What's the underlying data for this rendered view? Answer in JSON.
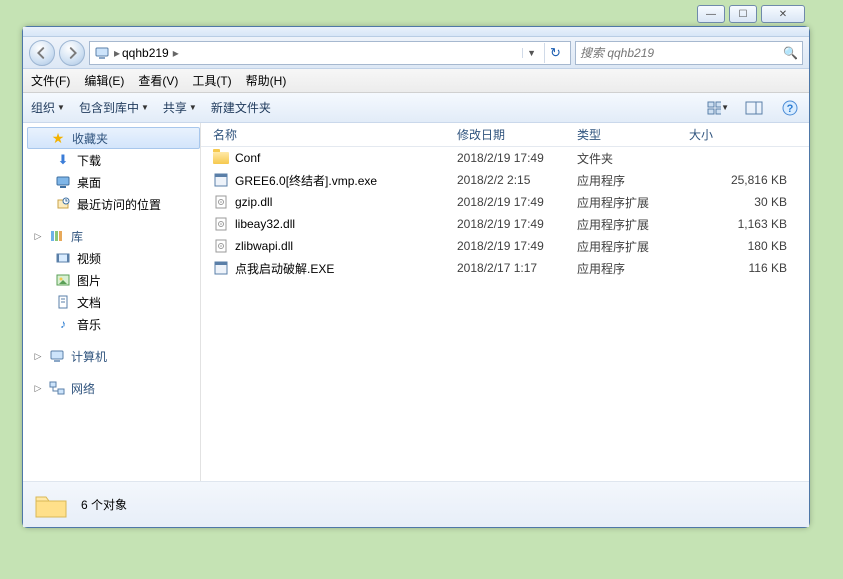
{
  "window_controls": {
    "min": "—",
    "max": "☐",
    "close": "✕"
  },
  "address": {
    "root_icon": "computer-icon",
    "crumb1": "qqhb219",
    "refresh": "↻"
  },
  "search": {
    "placeholder": "搜索 qqhb219",
    "icon": "🔍"
  },
  "menubar": [
    {
      "label": "文件(F)"
    },
    {
      "label": "编辑(E)"
    },
    {
      "label": "查看(V)"
    },
    {
      "label": "工具(T)"
    },
    {
      "label": "帮助(H)"
    }
  ],
  "toolbar": {
    "organize": "组织",
    "include": "包含到库中",
    "share": "共享",
    "newfolder": "新建文件夹"
  },
  "sidebar": {
    "favorites": {
      "label": "收藏夹",
      "items": [
        "下载",
        "桌面",
        "最近访问的位置"
      ]
    },
    "libraries": {
      "label": "库",
      "items": [
        "视频",
        "图片",
        "文档",
        "音乐"
      ]
    },
    "computer": {
      "label": "计算机"
    },
    "network": {
      "label": "网络"
    }
  },
  "columns": {
    "name": "名称",
    "date": "修改日期",
    "type": "类型",
    "size": "大小"
  },
  "rows": [
    {
      "icon": "folder",
      "name": "Conf",
      "date": "2018/2/19 17:49",
      "type": "文件夹",
      "size": ""
    },
    {
      "icon": "exe",
      "name": "GREE6.0[终结者].vmp.exe",
      "date": "2018/2/2 2:15",
      "type": "应用程序",
      "size": "25,816 KB"
    },
    {
      "icon": "dll",
      "name": "gzip.dll",
      "date": "2018/2/19 17:49",
      "type": "应用程序扩展",
      "size": "30 KB"
    },
    {
      "icon": "dll",
      "name": "libeay32.dll",
      "date": "2018/2/19 17:49",
      "type": "应用程序扩展",
      "size": "1,163 KB"
    },
    {
      "icon": "dll",
      "name": "zlibwapi.dll",
      "date": "2018/2/19 17:49",
      "type": "应用程序扩展",
      "size": "180 KB"
    },
    {
      "icon": "exe",
      "name": "点我启动破解.EXE",
      "date": "2018/2/17 1:17",
      "type": "应用程序",
      "size": "116 KB"
    }
  ],
  "status": {
    "count_label": "6 个对象"
  }
}
